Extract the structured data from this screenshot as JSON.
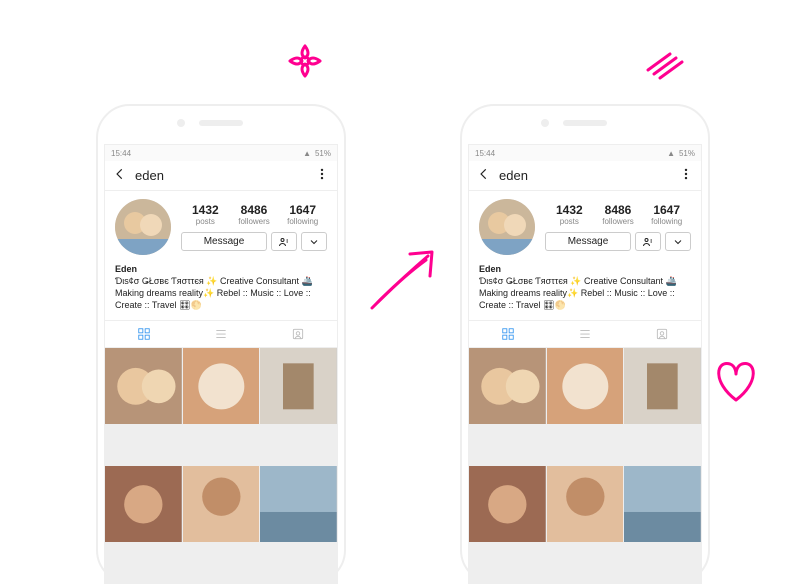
{
  "status": {
    "time": "15:44",
    "battery": "51%",
    "signal": "▲"
  },
  "header": {
    "username": "eden"
  },
  "stats": {
    "posts": {
      "count": "1432",
      "label": "posts"
    },
    "followers": {
      "count": "8486",
      "label": "followers"
    },
    "following": {
      "count": "1647",
      "label": "following"
    }
  },
  "actions": {
    "message": "Message"
  },
  "bio": {
    "name": "Eden",
    "line1": "Ɗιѕ¢σ ǤŁσвє Ƭяσττєя ✨ Creative Consultant 🚢",
    "line2": "Making dreams reality✨ Rebel :: Music :: Love :: Create :: Travel 🎛🌕"
  }
}
